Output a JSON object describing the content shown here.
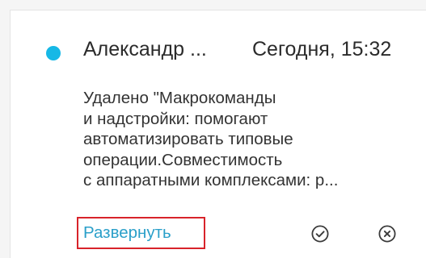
{
  "notification": {
    "author": "Александр ...",
    "time": "Сегодня, 15:32",
    "message_lines": [
      "Удалено \"Макрокоманды",
      "и надстройки: помогают",
      "автоматизировать типовые",
      "операции.Совместимость",
      "с аппаратными комплексами: р..."
    ],
    "expand_label": "Развернуть",
    "actions": {
      "accept_icon": "check-circle-icon",
      "dismiss_icon": "close-circle-icon"
    }
  },
  "colors": {
    "unread_dot": "#16b8e6",
    "link": "#2a9fc9",
    "highlight_border": "#d8232a"
  }
}
